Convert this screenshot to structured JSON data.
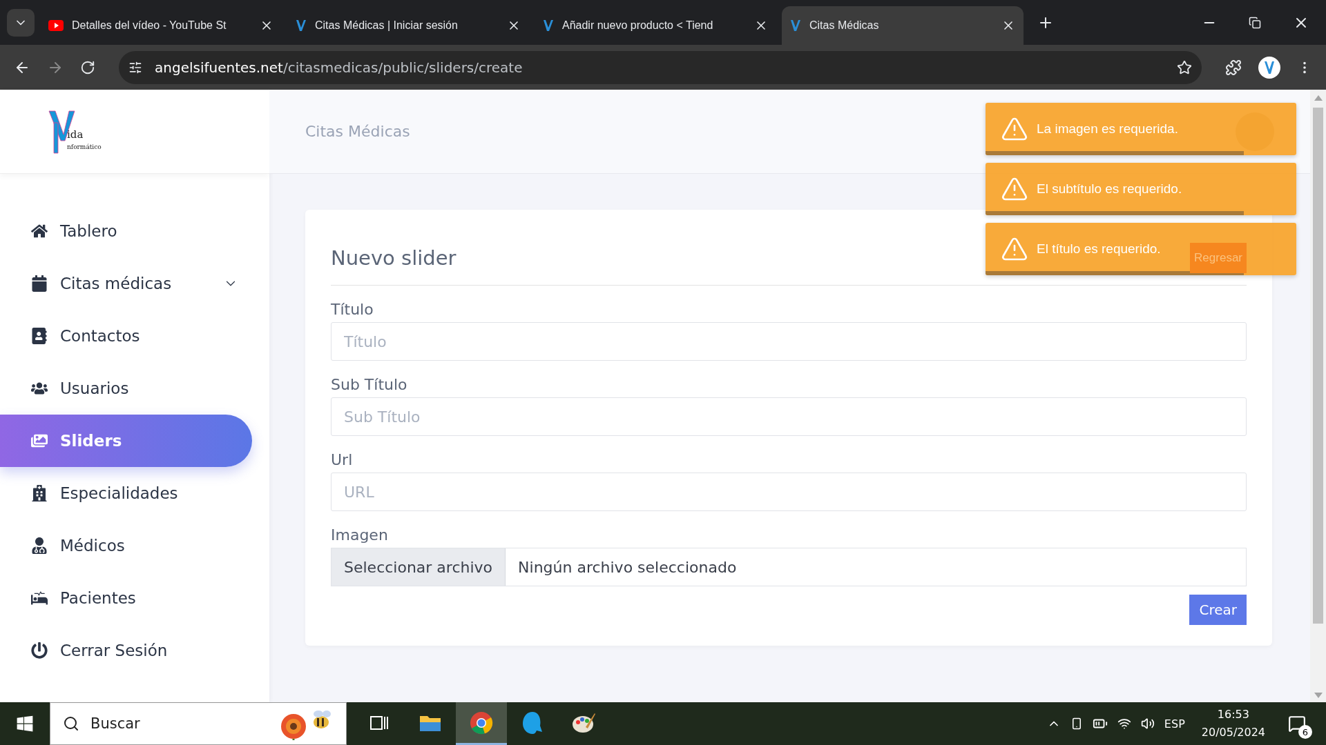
{
  "browser": {
    "tabs": [
      {
        "title": "Detalles del vídeo - YouTube St",
        "selected": false
      },
      {
        "title": "Citas Médicas | Iniciar sesión",
        "selected": false
      },
      {
        "title": "Añadir nuevo producto < Tiend",
        "selected": false
      },
      {
        "title": "Citas Médicas",
        "selected": true
      }
    ],
    "address": {
      "host": "angelsifuentes.net",
      "path": "/citasmedicas/public/sliders/create"
    }
  },
  "logo": {
    "line_1": "ida",
    "line_2": "nformático"
  },
  "sidebar": {
    "items": [
      {
        "label": "Tablero",
        "selected": false
      },
      {
        "label": "Citas médicas",
        "selected": false,
        "expanded": false
      },
      {
        "label": "Contactos",
        "selected": false
      },
      {
        "label": "Usuarios",
        "selected": false
      },
      {
        "label": "Sliders",
        "selected": true
      },
      {
        "label": "Especialidades",
        "selected": false
      },
      {
        "label": "Médicos",
        "selected": false
      },
      {
        "label": "Pacientes",
        "selected": false
      },
      {
        "label": "Cerrar Sesión",
        "selected": false
      }
    ]
  },
  "header": {
    "title": "Citas Médicas"
  },
  "card": {
    "title": "Nuevo slider",
    "back_button": "Regresar",
    "fields": [
      {
        "label": "Título",
        "placeholder": "Título"
      },
      {
        "label": "Sub Título",
        "placeholder": "Sub Título"
      },
      {
        "label": "Url",
        "placeholder": "URL"
      }
    ],
    "file": {
      "label": "Imagen",
      "button": "Seleccionar archivo",
      "status": "Ningún archivo seleccionado"
    },
    "submit": "Crear"
  },
  "toasts": [
    {
      "message": "La imagen es requerida.",
      "level": 0.83
    },
    {
      "message": "El subtítulo es requerido.",
      "level": 0.83
    },
    {
      "message": "El título es requerido.",
      "level": 0.83
    }
  ],
  "taskbar": {
    "search": "Buscar",
    "apps": [
      {
        "kind": "taskview",
        "selected": false
      },
      {
        "kind": "folder",
        "selected": false
      },
      {
        "kind": "chrome",
        "selected": true
      },
      {
        "kind": "bluebird",
        "selected": false
      },
      {
        "kind": "paint",
        "selected": false
      }
    ],
    "language": "ESP",
    "time": "16:53",
    "date": "20/05/2024",
    "notifications": "6"
  }
}
